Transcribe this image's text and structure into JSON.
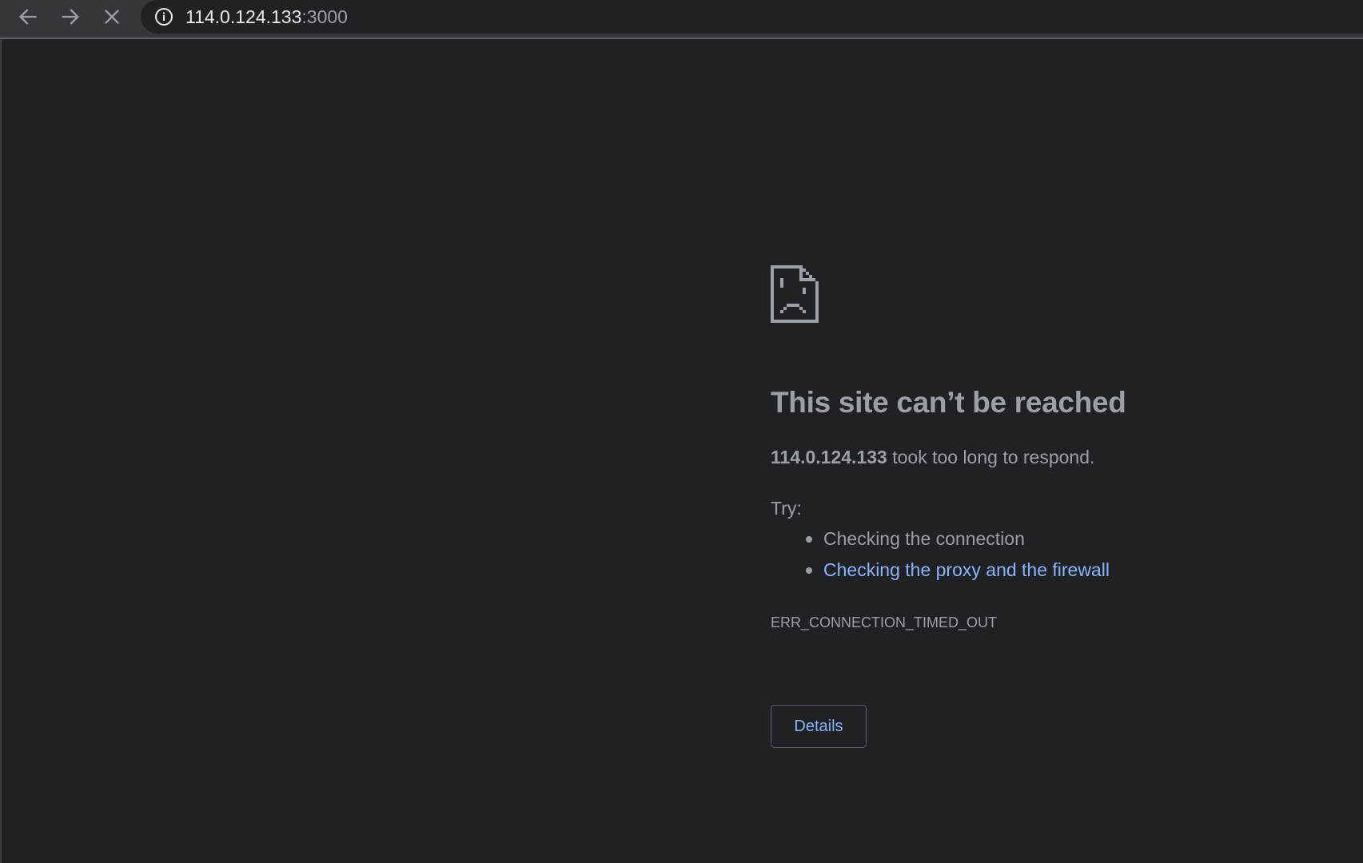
{
  "browser": {
    "icons": {
      "back": "arrow-left-icon",
      "forward": "arrow-right-icon",
      "stop": "close-icon",
      "site_info": "info-icon"
    },
    "url_host": "114.0.124.133",
    "url_port": ":3000"
  },
  "error_page": {
    "icon": "sad-document-icon",
    "headline": "This site can’t be reached",
    "summary_host": "114.0.124.133",
    "summary_text": " took too long to respond.",
    "try_label": "Try:",
    "suggestions": [
      {
        "label": "Checking the connection",
        "is_link": false
      },
      {
        "label": "Checking the proxy and the firewall",
        "is_link": true
      }
    ],
    "error_code": "ERR_CONNECTION_TIMED_OUT",
    "details_button": "Details"
  },
  "colors": {
    "page_background": "#202124",
    "toolbar_background": "#35363a",
    "text_secondary": "#9aa0a6",
    "link": "#8ab4f8"
  }
}
